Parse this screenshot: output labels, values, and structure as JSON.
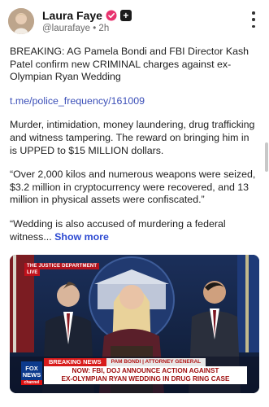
{
  "post": {
    "author": "Laura Faye",
    "handle": "@laurafaye",
    "separator": "•",
    "time": "2h",
    "plus_label": "+",
    "paragraphs": [
      "BREAKING: AG Pamela Bondi and FBI Director Kash Patel confirm new CRIMINAL charges against ex-Olympian Ryan Wedding",
      "Murder, intimidation, money laundering, drug trafficking and witness tampering. The reward on bringing him in is UPPED to $15 MILLION dollars.",
      "“Over 2,000 kilos and numerous weapons were seized, $3.2 million in cryptocurrency were recovered, and 13 million in physical assets were confiscated.”"
    ],
    "link": "t.me/police_frequency/161009",
    "last_paragraph": "“Wedding is also accused of murdering a federal witness...",
    "show_more": "Show more"
  },
  "video": {
    "dept_tag": "THE JUSTICE DEPARTMENT",
    "live_tag": "LIVE",
    "breaking_label": "BREAKING NEWS",
    "speaker_label": "PAM BONDI | ATTORNEY GENERAL",
    "headline_line1": "NOW: FBI, DOJ ANNOUNCE ACTION AGAINST",
    "headline_line2": "EX-OLYMPIAN RYAN WEDDING IN DRUG RING CASE",
    "network": "FOX NEWS",
    "network_sub": "channel"
  },
  "colors": {
    "link": "#3b4fb8",
    "verified": "#e8336e",
    "breaking_red": "#d81b1b"
  }
}
